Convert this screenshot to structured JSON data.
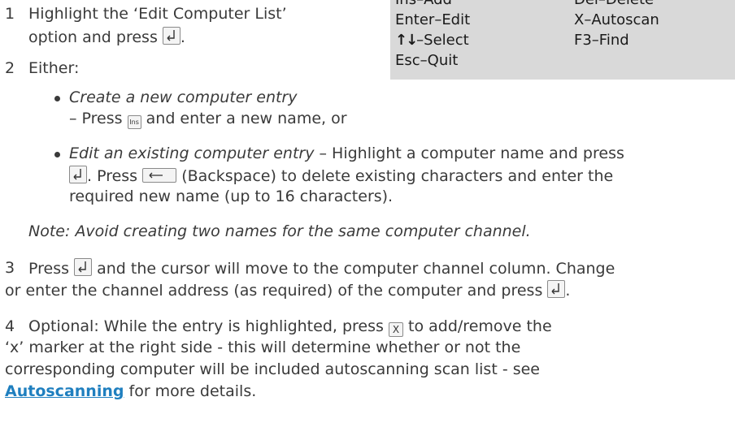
{
  "panel": {
    "row1_left": "Ins–Add",
    "row1_right": "Del–Delete",
    "row2_left": "Enter–Edit",
    "row2_right": "X–Autoscan",
    "row3_left": "–Select",
    "row3_right": "F3–Find",
    "row4_left": "Esc–Quit"
  },
  "steps": {
    "s1_num": "1",
    "s1_line1": "Highlight the ‘Edit Computer List’",
    "s1_line2": "option and press",
    "s2_num": "2",
    "s2_text": "Either:",
    "b1_title": "Create a new computer entry",
    "b1_dash": "– Press",
    "b1_rest": "and enter a new name, or",
    "b2_title": "Edit an existing computer entry",
    "b2_rest": "– Highlight a computer name and press",
    "b2_line2a": ". Press",
    "b2_line2b": "(Backspace) to delete existing characters and enter the",
    "b2_line3": "required new name (up to 16 characters).",
    "note_label": "Note:",
    "note_text": "Avoid creating two names for the same computer channel",
    "s3_num": "3",
    "s3_line1a": "Press",
    "s3_line1b": "and the cursor will move to the computer channel column. Change",
    "s3_line2": "or enter the channel address (as required) of the computer and press",
    "s4_num": "4",
    "s4_line1a": "Optional: While the entry is highlighted, press",
    "s4_line1b": "to add/remove the",
    "s4_line2": "‘x’ marker at the right side - this will determine whether or not the",
    "s4_line3": "corresponding computer will be included autoscanning scan list - see",
    "s4_link": "Autoscanning",
    "s4_line4": "for more details."
  },
  "keys": {
    "ins": "Ins",
    "x": "X"
  }
}
